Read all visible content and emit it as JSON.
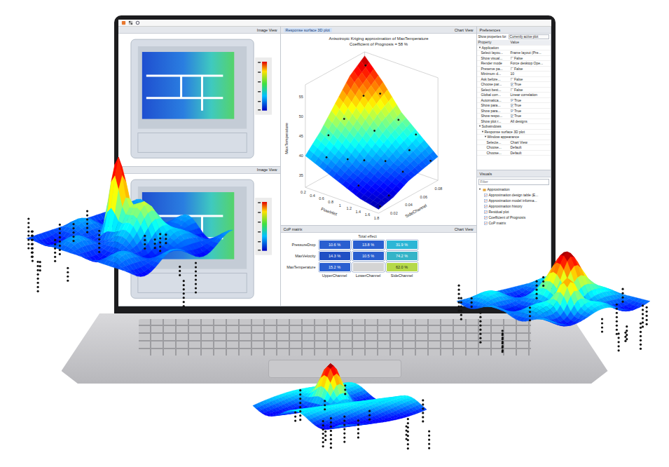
{
  "image_views": [
    {
      "title": "Image View"
    },
    {
      "title": "Image View"
    }
  ],
  "response_surface": {
    "pane_title": "Response surface 3D plot",
    "pane_tab": "Chart View",
    "title": "Anisotropic Kriging approximation of MaxTemperature",
    "subtitle": "Coefficient of Prognosis = 58 %",
    "z_axis": {
      "label": "MaxTemperature",
      "ticks": [
        "35",
        "40",
        "45",
        "50",
        "55"
      ],
      "min": 32,
      "max": 58
    },
    "x_axis": {
      "label": "FlowInlet",
      "ticks": [
        "0.2",
        "0.4",
        "0.6",
        "0.8",
        "1",
        "1.2",
        "1.4",
        "1.6",
        "1.8"
      ],
      "min": 0.2,
      "max": 1.8
    },
    "y_axis": {
      "label": "SideChannel",
      "ticks": [
        "0.02",
        "0.04",
        "0.06",
        "0.08"
      ],
      "min": 0.01,
      "max": 0.09
    },
    "grid_x": [
      0.2,
      0.6,
      1.0,
      1.4,
      1.8
    ],
    "grid_y": [
      0.01,
      0.03,
      0.05,
      0.07,
      0.09
    ],
    "z": [
      [
        40,
        44,
        49,
        54,
        57
      ],
      [
        38,
        41,
        45,
        49,
        52
      ],
      [
        36,
        38,
        41,
        44,
        46
      ],
      [
        34,
        36,
        38,
        40,
        42
      ],
      [
        33,
        34,
        36,
        37,
        38
      ]
    ],
    "points": [
      [
        0.3,
        0.085,
        55.5
      ],
      [
        0.5,
        0.07,
        50.2
      ],
      [
        0.4,
        0.05,
        46
      ],
      [
        0.7,
        0.08,
        50.5
      ],
      [
        0.9,
        0.06,
        44
      ],
      [
        1.1,
        0.08,
        45.5
      ],
      [
        1.3,
        0.05,
        39
      ],
      [
        1.5,
        0.07,
        40.5
      ],
      [
        1.7,
        0.03,
        34
      ],
      [
        1.6,
        0.055,
        37
      ],
      [
        1.2,
        0.02,
        35.5
      ],
      [
        0.8,
        0.03,
        39.5
      ],
      [
        0.5,
        0.02,
        39.8
      ],
      [
        1.0,
        0.04,
        39
      ],
      [
        1.4,
        0.085,
        42.5
      ],
      [
        1.8,
        0.08,
        38
      ],
      [
        0.3,
        0.035,
        43
      ],
      [
        1.75,
        0.015,
        33
      ]
    ]
  },
  "cop_matrix": {
    "pane_title": "CoP matrix",
    "pane_tab": "Chart View",
    "header": "Total effect",
    "columns": [
      "UpperChannel",
      "LowerChannel",
      "SideChannel"
    ],
    "rows": [
      {
        "label": "PressureDrop",
        "cells": [
          {
            "value": "10.6 %",
            "color": "#2a5fd0"
          },
          {
            "value": "13.8 %",
            "color": "#2a5fd0"
          },
          {
            "value": "31.9 %",
            "color": "#2cb6d6"
          }
        ]
      },
      {
        "label": "MaxVelocity",
        "cells": [
          {
            "value": "14.3 %",
            "color": "#1f4fc4"
          },
          {
            "value": "10.5 %",
            "color": "#2a5fd0"
          },
          {
            "value": "74.2 %",
            "color": "#35b4c8"
          }
        ]
      },
      {
        "label": "MaxTemperature",
        "cells": [
          {
            "value": "15.2 %",
            "color": "#2a5fd0"
          },
          {
            "value": "",
            "color": "#d4d4d4"
          },
          {
            "value": "62.0 %",
            "color": "#b5d94a"
          }
        ]
      }
    ]
  },
  "preferences": {
    "title": "Preferences",
    "show_for_label": "Show properties for:",
    "show_for_value": "Currently active plot",
    "columns": [
      "Property",
      "Value"
    ],
    "rows": [
      {
        "kind": "group",
        "name": "Application",
        "expanded": true,
        "depth": 0
      },
      {
        "kind": "text",
        "name": "Select layou...",
        "value": "Frame layout (Pre...",
        "depth": 1
      },
      {
        "kind": "check",
        "name": "Show visual...",
        "value": "False",
        "checked": false,
        "depth": 1
      },
      {
        "kind": "text",
        "name": "Render mode",
        "value": "Force desktop Ope...",
        "depth": 1
      },
      {
        "kind": "check",
        "name": "Preserve pa...",
        "value": "False",
        "checked": false,
        "depth": 1
      },
      {
        "kind": "text",
        "name": "Minimum d...",
        "value": "10",
        "depth": 1
      },
      {
        "kind": "check",
        "name": "Ask before...",
        "value": "False",
        "checked": false,
        "depth": 1
      },
      {
        "kind": "check",
        "name": "Choose par...",
        "value": "True",
        "checked": true,
        "depth": 1
      },
      {
        "kind": "check",
        "name": "Select best...",
        "value": "False",
        "checked": false,
        "depth": 1
      },
      {
        "kind": "text",
        "name": "Global corr...",
        "value": "Linear correlation",
        "depth": 1
      },
      {
        "kind": "check",
        "name": "Automatica...",
        "value": "True",
        "checked": true,
        "depth": 1
      },
      {
        "kind": "check",
        "name": "Show para...",
        "value": "True",
        "checked": true,
        "depth": 1
      },
      {
        "kind": "check",
        "name": "Show para...",
        "value": "True",
        "checked": true,
        "depth": 1
      },
      {
        "kind": "check",
        "name": "Show respo...",
        "value": "True",
        "checked": true,
        "depth": 1
      },
      {
        "kind": "text",
        "name": "Show plot r...",
        "value": "All designs",
        "depth": 1
      },
      {
        "kind": "group",
        "name": "Subwindows",
        "expanded": true,
        "depth": 0
      },
      {
        "kind": "group",
        "name": "Response surface 3D plot",
        "expanded": true,
        "depth": 1
      },
      {
        "kind": "group",
        "name": "Window appearance",
        "expanded": true,
        "depth": 2
      },
      {
        "kind": "text",
        "name": "Selecte...",
        "value": "Chart View",
        "depth": 3
      },
      {
        "kind": "text",
        "name": "Choose...",
        "value": "Default",
        "depth": 3
      },
      {
        "kind": "text",
        "name": "Choose...",
        "value": "Default",
        "depth": 3
      }
    ]
  },
  "visuals": {
    "title": "Visuals",
    "filter_placeholder": "Filter",
    "group": "Approximation",
    "expanded": true,
    "items": [
      "Approximation design table (E...",
      "Approximation model informa...",
      "Approximation history",
      "Residual plot",
      "Coefficient of Prognosis",
      "CoP matrix"
    ]
  }
}
